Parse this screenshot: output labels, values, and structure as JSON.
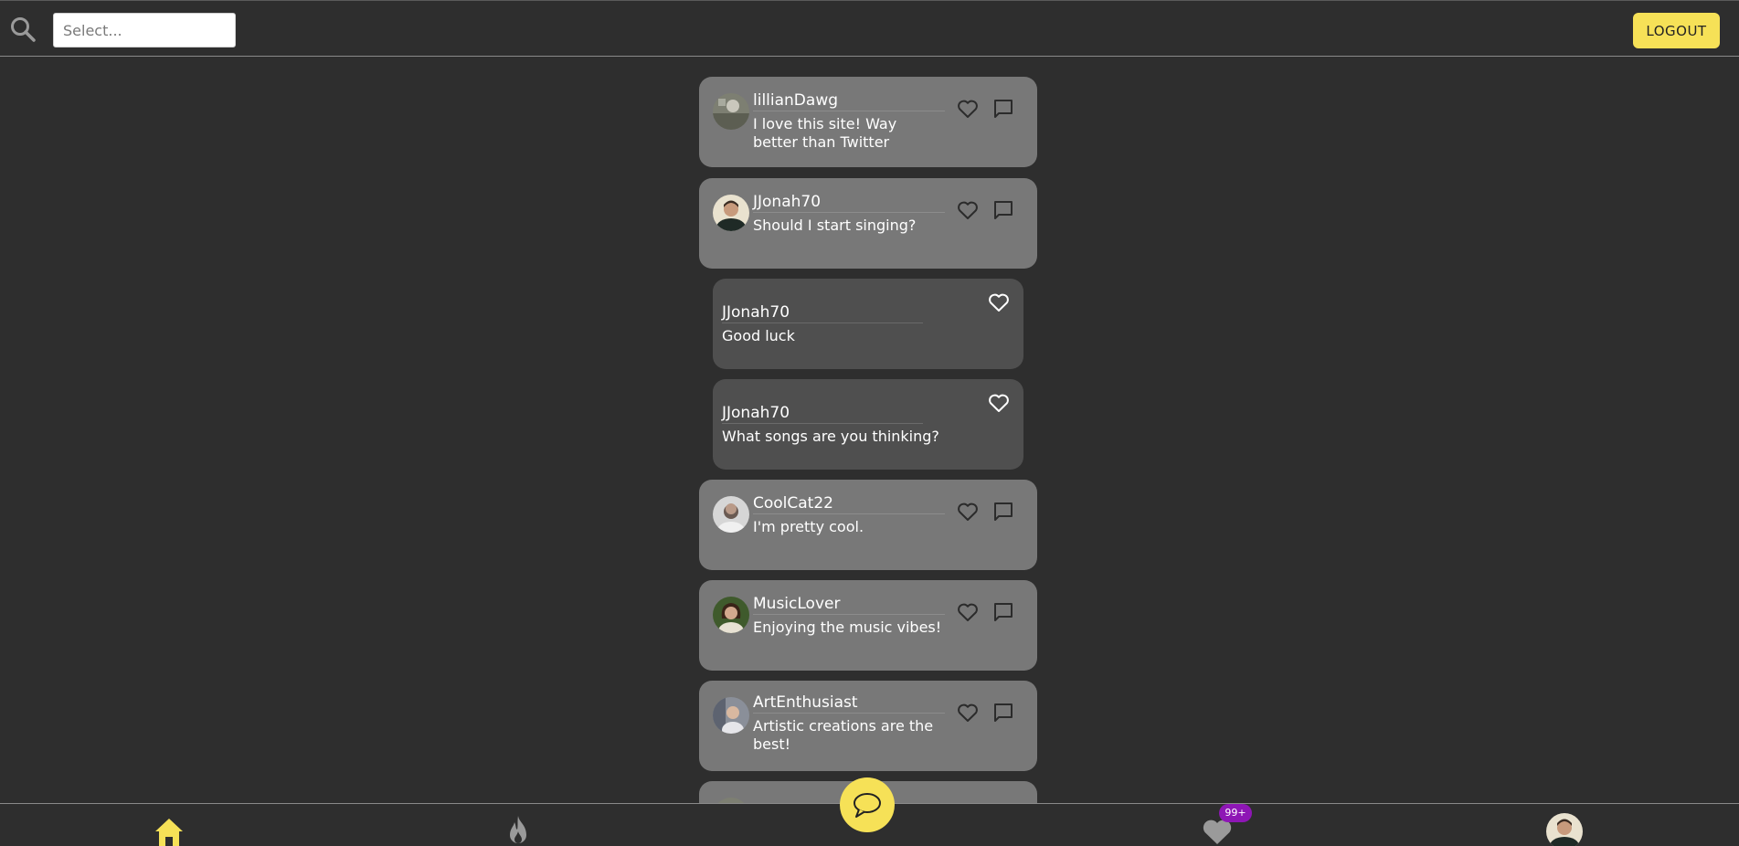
{
  "search": {
    "placeholder": "Select..."
  },
  "header": {
    "logout_label": "LOGOUT"
  },
  "posts": [
    {
      "username": "lillianDawg",
      "text": "I love this site! Way better than Twitter"
    },
    {
      "username": "JJonah70",
      "text": "Should I start singing?"
    },
    {
      "username": "CoolCat22",
      "text": "I'm pretty cool."
    },
    {
      "username": "MusicLover",
      "text": "Enjoying the music vibes!"
    },
    {
      "username": "ArtEnthusiast",
      "text": "Artistic creations are the best!"
    }
  ],
  "replies": [
    {
      "username": "JJonah70",
      "text": "Good luck"
    },
    {
      "username": "JJonah70",
      "text": "What songs are you thinking?"
    }
  ],
  "nav": {
    "likes_badge": "99+"
  },
  "colors": {
    "accent": "#f6e157",
    "badge": "#8e16b5",
    "post_bg": "#787878",
    "reply_bg": "#4f4f4f",
    "page_bg": "#2e2e2e"
  },
  "icons": [
    "search-icon",
    "heart-icon",
    "comment-icon",
    "home-icon",
    "flame-icon",
    "chat-icon"
  ]
}
